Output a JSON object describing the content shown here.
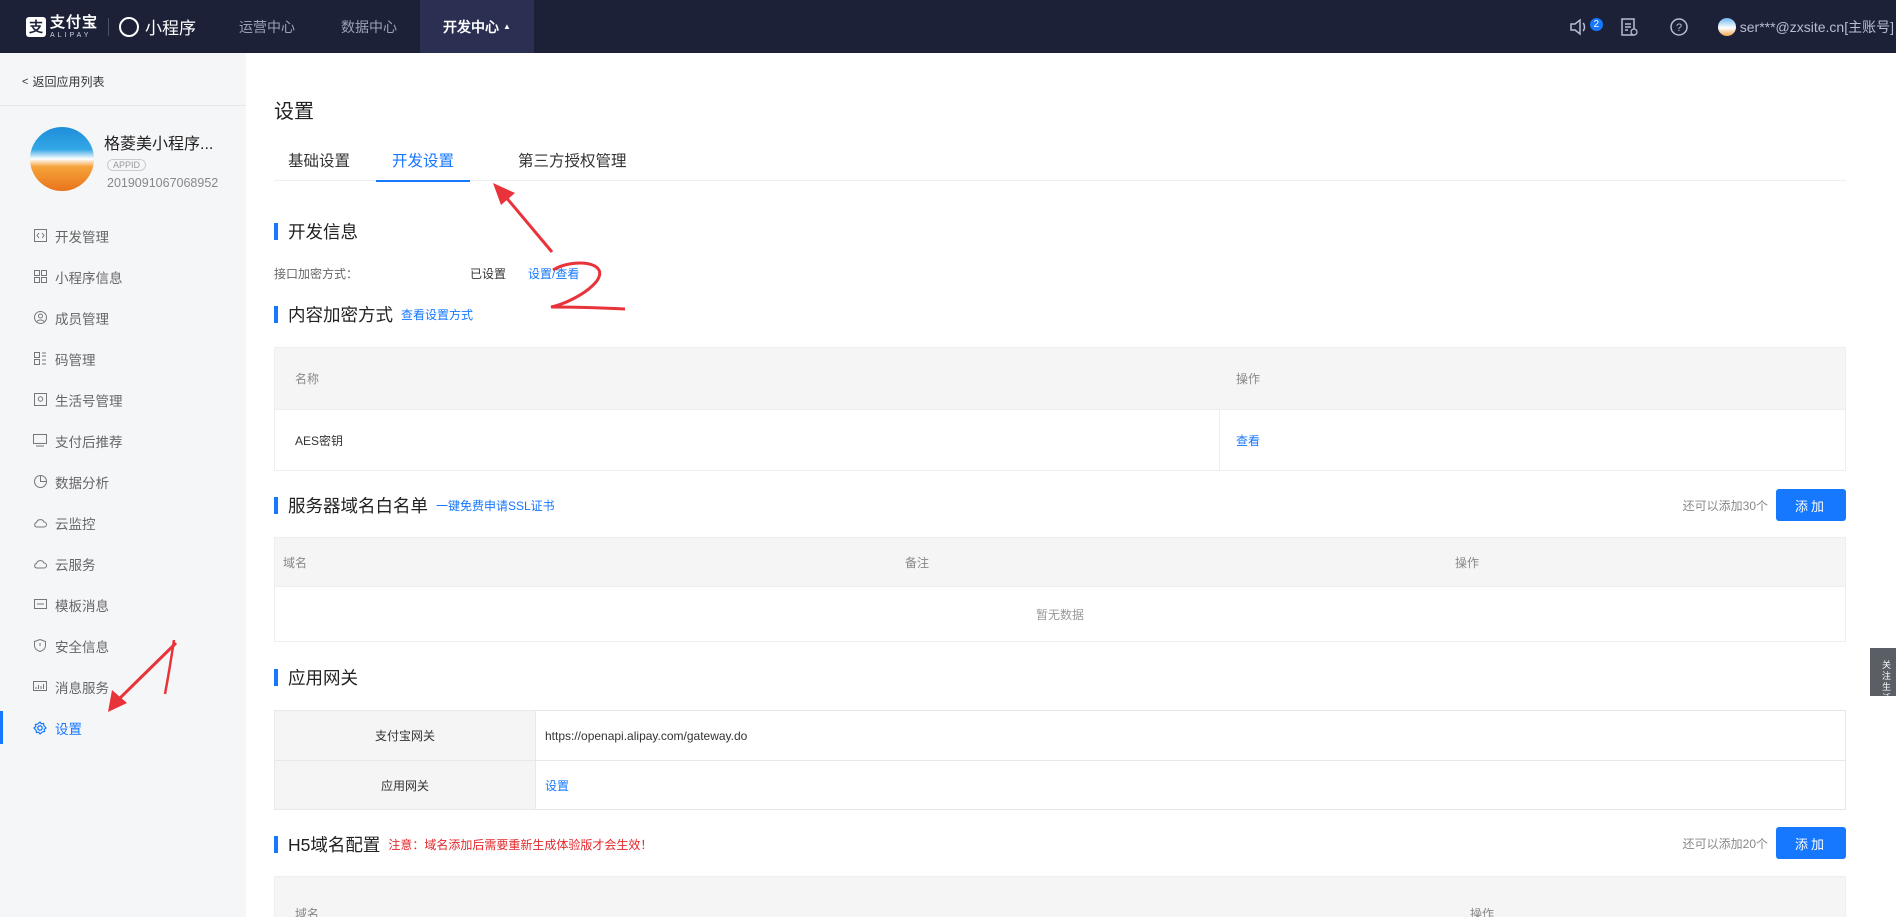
{
  "topbar": {
    "logo": {
      "alipay_cn": "支付宝",
      "alipay_en": "ALIPAY",
      "alipay_mark": "支",
      "product": "小程序"
    },
    "nav": [
      {
        "label": "运营中心"
      },
      {
        "label": "数据中心"
      },
      {
        "label": "开发中心",
        "active": true
      }
    ],
    "notification_count": "2",
    "user": "ser***@zxsite.cn[主账号]"
  },
  "sidebar": {
    "back": "返回应用列表",
    "app": {
      "name": "格菱美小程序...",
      "appid_tag": "APPID",
      "appid": "2019091067068952"
    },
    "items": [
      {
        "label": "开发管理",
        "icon": "code-icon"
      },
      {
        "label": "小程序信息",
        "icon": "grid-icon"
      },
      {
        "label": "成员管理",
        "icon": "user-circle-icon"
      },
      {
        "label": "码管理",
        "icon": "qrcode-icon"
      },
      {
        "label": "生活号管理",
        "icon": "life-account-icon"
      },
      {
        "label": "支付后推荐",
        "icon": "monitor-icon"
      },
      {
        "label": "数据分析",
        "icon": "pie-chart-icon"
      },
      {
        "label": "云监控",
        "icon": "cloud-icon"
      },
      {
        "label": "云服务",
        "icon": "cloud-icon"
      },
      {
        "label": "模板消息",
        "icon": "message-icon"
      },
      {
        "label": "安全信息",
        "icon": "shield-icon"
      },
      {
        "label": "消息服务",
        "icon": "signal-icon"
      },
      {
        "label": "设置",
        "icon": "gear-icon",
        "active": true
      }
    ]
  },
  "main": {
    "title": "设置",
    "tabs": [
      {
        "label": "基础设置"
      },
      {
        "label": "开发设置",
        "active": true
      },
      {
        "label": "第三方授权管理"
      }
    ],
    "dev_info": {
      "title": "开发信息",
      "key": "接口加密方式：",
      "status": "已设置",
      "action": "设置/查看"
    },
    "content_encrypt": {
      "title": "内容加密方式",
      "link": "查看设置方式",
      "columns": [
        "名称",
        "操作"
      ],
      "rows": [
        {
          "name": "AES密钥",
          "action": "查看"
        }
      ]
    },
    "server_whitelist": {
      "title": "服务器域名白名单",
      "link": "一键免费申请SSL证书",
      "remaining": "还可以添加30个",
      "add": "添加",
      "columns": [
        "域名",
        "备注",
        "操作"
      ],
      "empty": "暂无数据"
    },
    "gateway": {
      "title": "应用网关",
      "rows": [
        {
          "key": "支付宝网关",
          "value": "https://openapi.alipay.com/gateway.do"
        },
        {
          "key": "应用网关",
          "value": "设置"
        }
      ]
    },
    "h5_domain": {
      "title": "H5域名配置",
      "warning": "注意：域名添加后需要重新生成体验版才会生效！",
      "remaining": "还可以添加20个",
      "add": "添加",
      "columns": [
        "域名",
        "操作"
      ]
    }
  },
  "float_tab": {
    "text": "关注生活号"
  },
  "colors": {
    "primary": "#1677ff",
    "topbar": "#1d2137",
    "warning": "#e5282c",
    "annotation": "#e8333a"
  }
}
